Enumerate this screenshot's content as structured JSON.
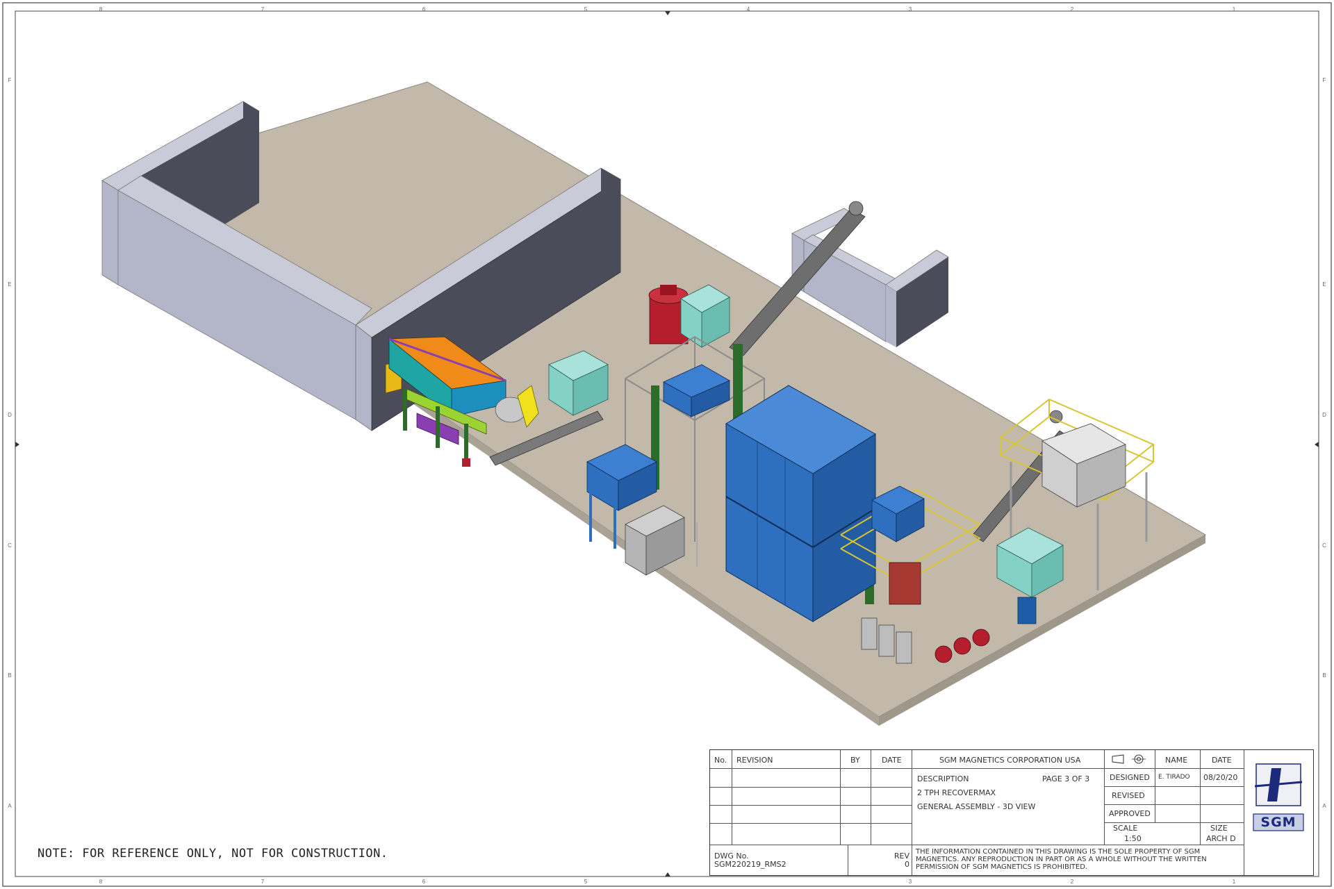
{
  "drawing": {
    "note": "NOTE: FOR REFERENCE ONLY, NOT FOR CONSTRUCTION.",
    "zones_top": [
      "8",
      "7",
      "6",
      "5",
      "4",
      "3",
      "2",
      "1"
    ],
    "zones_side": [
      "F",
      "E",
      "D",
      "C",
      "B",
      "A"
    ]
  },
  "title_block": {
    "revision_headers": {
      "no": "No.",
      "revision": "REVISION",
      "by": "BY",
      "date": "DATE"
    },
    "company": "SGM MAGNETICS CORPORATION USA",
    "description_label": "DESCRIPTION",
    "page": "PAGE 3 OF 3",
    "description_line1": "2 TPH RECOVERMAX",
    "description_line2": "GENERAL ASSEMBLY - 3D VIEW",
    "name_header": "NAME",
    "date_header": "DATE",
    "designed_label": "DESIGNED",
    "designed_name": "E. TIRADO",
    "designed_date": "08/20/20",
    "revised_label": "REVISED",
    "approved_label": "APPROVED",
    "scale_label": "SCALE",
    "scale_value": "1:50",
    "size_label": "SIZE",
    "size_value": "ARCH D",
    "dwg_label": "DWG No.",
    "dwg_value": "SGM220219_RMS2",
    "rev_label": "REV",
    "rev_value": "0",
    "disclaimer": "THE INFORMATION CONTAINED IN THIS DRAWING IS THE SOLE PROPERTY OF SGM MAGNETICS. ANY REPRODUCTION IN PART OR AS A WHOLE WITHOUT THE WRITTEN PERMISSION OF SGM MAGNETICS IS PROHIBITED.",
    "logo_text": "SGM"
  },
  "colors": {
    "floor": "#c2b9aa",
    "wall_light": "#b3b6c8",
    "wall_top": "#c9cbd8",
    "wall_dark": "#4a4c59",
    "blue": "#2e6fc0",
    "teal": "#84d2c6",
    "red": "#b51e2c",
    "green": "#2c6b2a",
    "yellow_rail": "#d8c531",
    "conveyor": "#6e6e6e",
    "orange": "#f08a18",
    "purple": "#8a3fb0"
  }
}
